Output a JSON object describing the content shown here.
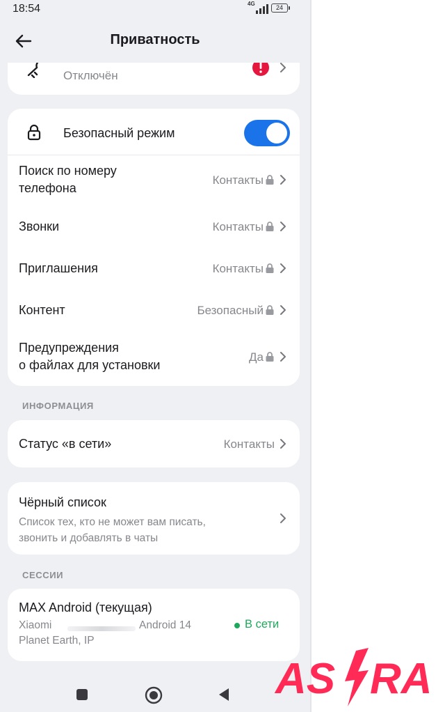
{
  "status_bar": {
    "time": "18:54",
    "network": "4G",
    "battery": "24"
  },
  "header": {
    "title": "Приватность"
  },
  "top_card": {
    "subtitle": "Отключён"
  },
  "safe_mode": {
    "label": "Безопасный режим",
    "enabled": true,
    "accent_color": "#1a73e8",
    "rows": [
      {
        "label_line1": "Поиск по номеру",
        "label_line2": "телефона",
        "value": "Контакты"
      },
      {
        "label": "Звонки",
        "value": "Контакты"
      },
      {
        "label": "Приглашения",
        "value": "Контакты"
      },
      {
        "label": "Контент",
        "value": "Безопасный"
      },
      {
        "label_line1": "Предупреждения",
        "label_line2": "о файлах для установки",
        "value": "Да"
      }
    ]
  },
  "information": {
    "section_title": "ИНФОРМАЦИЯ",
    "online_status": {
      "label": "Статус «в сети»",
      "value": "Контакты"
    }
  },
  "blacklist": {
    "title": "Чёрный список",
    "desc_line1": "Список тех, кто не может вам писать,",
    "desc_line2": "звонить и добавлять в чаты"
  },
  "sessions": {
    "section_title": "СЕССИИ",
    "current": {
      "title": "MAX Android (текущая)",
      "device_brand": "Xiaomi",
      "os": "Android 14",
      "location": "Planet Earth, IP",
      "status": "В сети",
      "status_color": "#1fa85b"
    }
  },
  "watermark": {
    "text_left": "AS",
    "text_right": "RA",
    "color": "#ff2b56"
  }
}
